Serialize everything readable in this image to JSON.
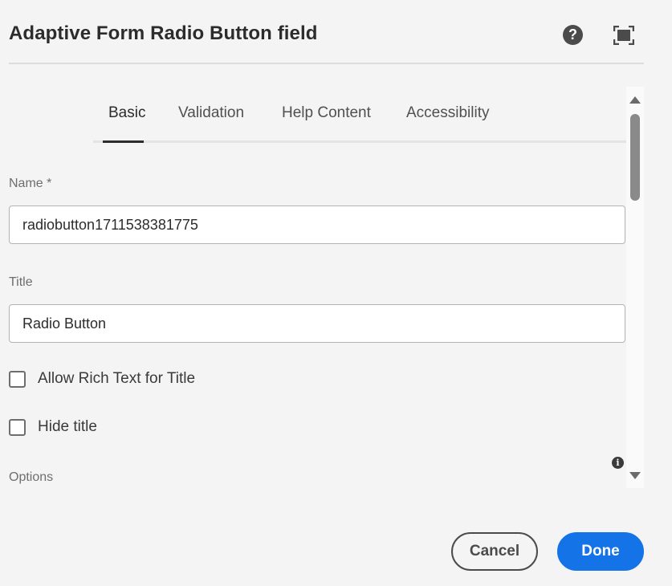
{
  "dialog": {
    "title": "Adaptive Form Radio Button field",
    "help_icon": "question-circle-icon",
    "help_glyph": "?",
    "fullscreen_icon": "fullscreen-icon"
  },
  "tabs": [
    {
      "label": "Basic",
      "active": true
    },
    {
      "label": "Validation",
      "active": false
    },
    {
      "label": "Help Content",
      "active": false
    },
    {
      "label": "Accessibility",
      "active": false
    }
  ],
  "fields": {
    "name": {
      "label": "Name *",
      "value": "radiobutton1711538381775"
    },
    "title": {
      "label": "Title",
      "value": "Radio Button"
    },
    "allow_rich_text": {
      "label": "Allow Rich Text for Title",
      "checked": false
    },
    "hide_title": {
      "label": "Hide title",
      "checked": false
    },
    "options": {
      "label": "Options",
      "info_icon": "info-icon",
      "info_glyph": "i"
    }
  },
  "footer": {
    "cancel_label": "Cancel",
    "done_label": "Done"
  },
  "colors": {
    "primary": "#1473e6",
    "text": "#2c2c2c",
    "background": "#f4f4f4"
  }
}
